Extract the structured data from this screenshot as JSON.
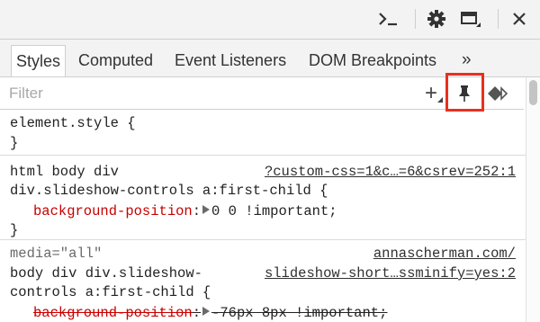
{
  "toolbar": {
    "icons": [
      "console-prompt-icon",
      "gear-icon",
      "dock-side-icon",
      "close-icon"
    ]
  },
  "tabs": {
    "items": [
      {
        "label": "Styles",
        "active": true
      },
      {
        "label": "Computed",
        "active": false
      },
      {
        "label": "Event Listeners",
        "active": false
      },
      {
        "label": "DOM Breakpoints",
        "active": false
      }
    ],
    "more": "»"
  },
  "filter": {
    "placeholder": "Filter",
    "value": "",
    "new_rule": "+",
    "pin_highlight_color": "#e8301e"
  },
  "rules": [
    {
      "selector": "element.style {",
      "close": "}"
    },
    {
      "source": "?custom-css=1&c…=6&csrev=252:1",
      "selector_line1": "html body div",
      "selector_line2": "div.slideshow-controls a:first-child {",
      "prop_name": "background-position",
      "prop_value": "0 0 !important;",
      "close": "}"
    },
    {
      "media": "media=\"all\"",
      "source_line1": "annascherman.com/",
      "source_line2": "slideshow-short…ssminify=yes:2",
      "selector_line1": "body div div.slideshow-",
      "selector_line2": "controls a:first-child {",
      "prop_name": "background-position",
      "prop_value": "-76px 8px !important;"
    }
  ]
}
